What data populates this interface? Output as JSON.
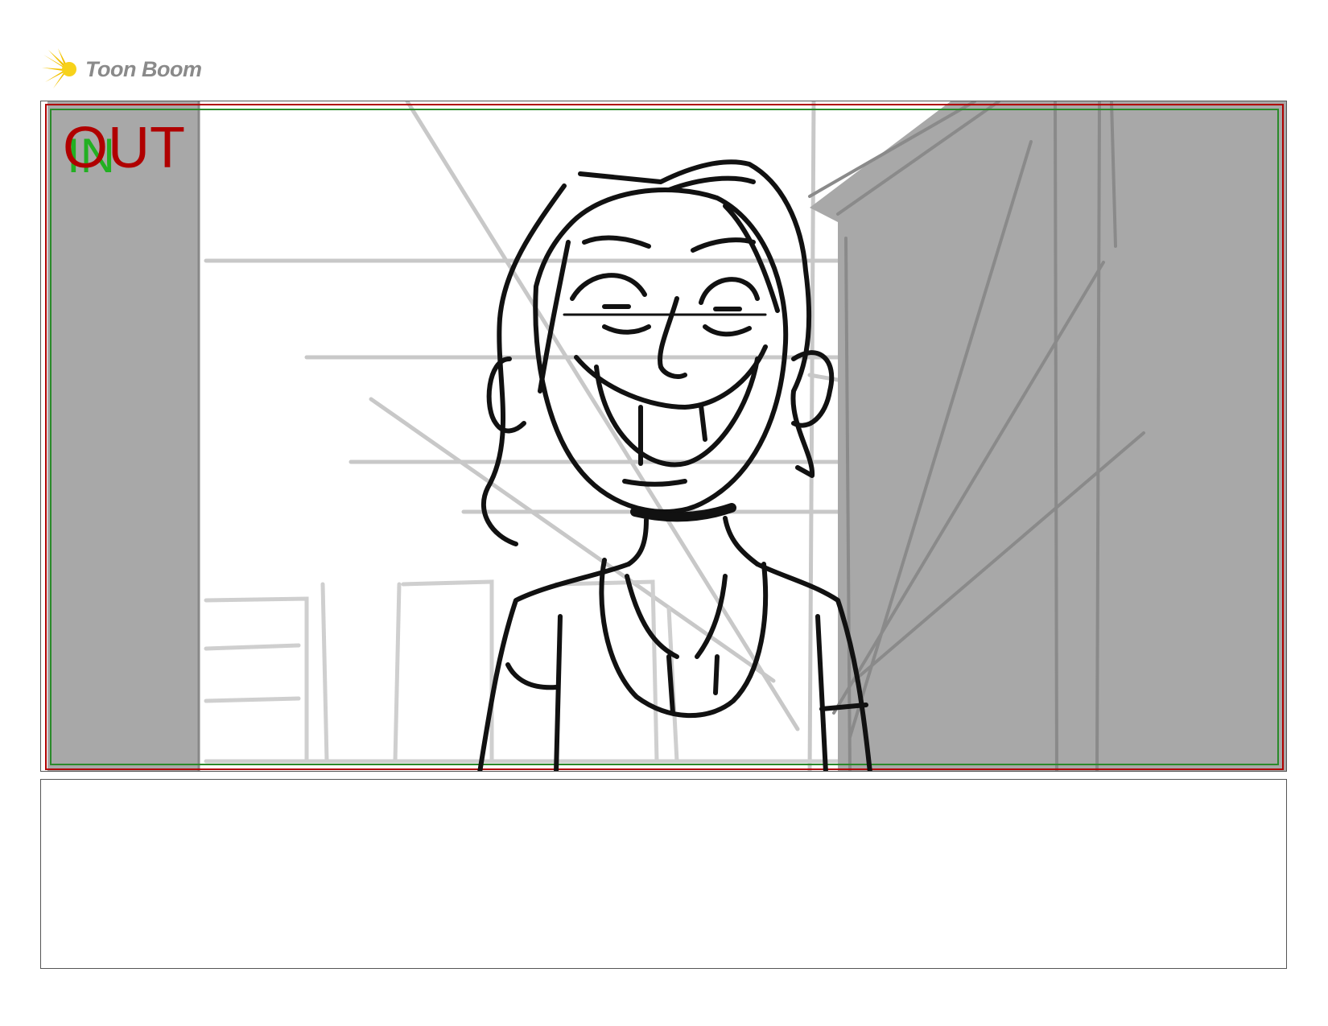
{
  "logo": {
    "text": "Toon Boom",
    "icon": "sunburst-logo-icon",
    "accent": "#f2c200"
  },
  "panel": {
    "labels": {
      "out": "OUT",
      "in": "IN"
    },
    "colors": {
      "out": "#b00000",
      "in": "#22b022",
      "sketch": "#111111",
      "overlay": "#a8a8a8"
    }
  },
  "notes": {
    "text": ""
  }
}
